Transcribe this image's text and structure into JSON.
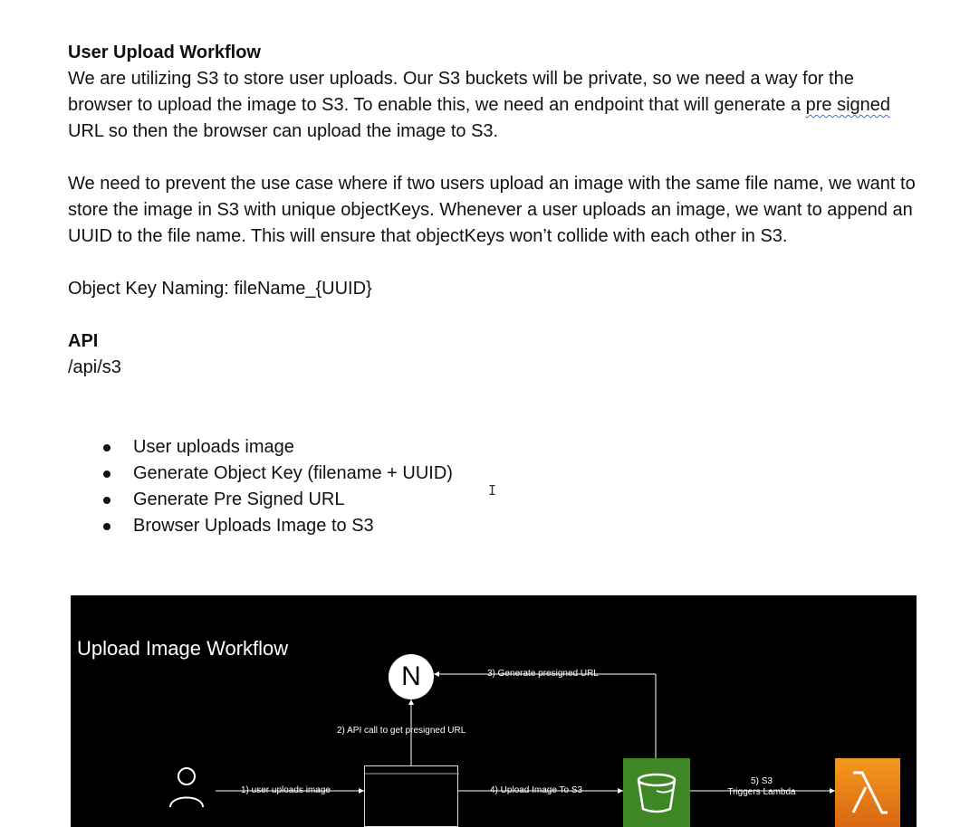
{
  "doc": {
    "heading": "User Upload Workflow",
    "para1_part1": "We are utilizing S3 to store user uploads. Our S3 buckets will be private, so we need a way for the browser to upload the image to S3. To enable this, we need an endpoint that will generate a ",
    "para1_misspelled": "pre signed",
    "para1_part2": " URL so then the browser can upload the image to S3.",
    "para2": "We need to prevent the use case where if two users upload an image with the same file name, we want to store the image in S3 with unique objectKeys. Whenever a user uploads an image, we want to append an UUID to the file name. This will ensure that objectKeys won’t collide with each other in S3.",
    "object_key_naming": "Object Key Naming: fileName_{UUID}",
    "api_heading": "API",
    "api_path": "/api/s3",
    "steps": [
      "User uploads image",
      "Generate Object Key (filename + UUID)",
      "Generate Pre Signed URL",
      "Browser Uploads Image to S3"
    ]
  },
  "diagram": {
    "title": "Upload Image Workflow",
    "nextjs_glyph": "N",
    "step1": "1) user uploads image",
    "step2": "2) API call to get presigned URL",
    "step3": "3) Generate presigned URL",
    "step4": "4) Upload Image To S3",
    "step5_line1": "5) S3",
    "step5_line2": "Triggers Lambda",
    "icons": {
      "user": "user-icon",
      "server": "nextjs-icon",
      "browser": "browser-window-icon",
      "bucket": "s3-bucket-icon",
      "lambda": "lambda-icon"
    },
    "colors": {
      "background": "#000000",
      "s3": "#3f8624",
      "lambda": "#e07414"
    }
  }
}
